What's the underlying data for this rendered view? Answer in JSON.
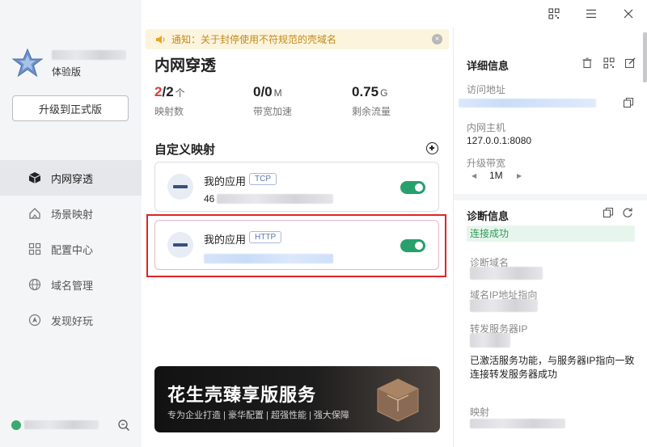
{
  "sidebar": {
    "edition": "体验版",
    "upgrade_label": "升级到正式版",
    "nav": [
      {
        "label": "内网穿透",
        "icon": "cube-icon"
      },
      {
        "label": "场景映射",
        "icon": "house-scene-icon"
      },
      {
        "label": "配置中心",
        "icon": "grid-config-icon"
      },
      {
        "label": "域名管理",
        "icon": "domain-globe-icon"
      },
      {
        "label": "发现好玩",
        "icon": "compass-icon"
      }
    ]
  },
  "notice": {
    "text": "通知：关于封停使用不符规范的壳域名"
  },
  "main": {
    "title": "内网穿透",
    "stats": [
      {
        "used": "2",
        "total": "/2",
        "unit": "个",
        "label": "映射数"
      },
      {
        "value": "0/0",
        "unit": "M",
        "label": "带宽加速"
      },
      {
        "value": "0.75",
        "unit": "G",
        "label": "剩余流量"
      }
    ],
    "section_title": "自定义映射",
    "mappings": [
      {
        "name": "我的应用",
        "protocol": "TCP",
        "address_prefix": "46",
        "enabled": true
      },
      {
        "name": "我的应用",
        "protocol": "HTTP",
        "address_prefix": "",
        "enabled": true
      }
    ]
  },
  "banner": {
    "title": "花生壳臻享版服务",
    "subtitle": "专为企业打造 | 豪华配置 | 超强性能 | 强大保障"
  },
  "details": {
    "title": "详细信息",
    "access_label": "访问地址",
    "host_label": "内网主机",
    "host_value": "127.0.0.1:8080",
    "bandwidth_label": "升级带宽",
    "bandwidth_value": "1M"
  },
  "diagnosis": {
    "title": "诊断信息",
    "status": "连接成功",
    "domain_label": "诊断域名",
    "ip_label": "域名IP地址指向",
    "server_label": "转发服务器IP",
    "message": "已激活服务功能，与服务器IP指向一致连接转发服务器成功",
    "mapping_label": "映射"
  },
  "colors": {
    "accent_green": "#27a06d",
    "danger_red": "#d93a3a",
    "notice_text": "#c08a1b",
    "highlight_border": "#e02424"
  }
}
